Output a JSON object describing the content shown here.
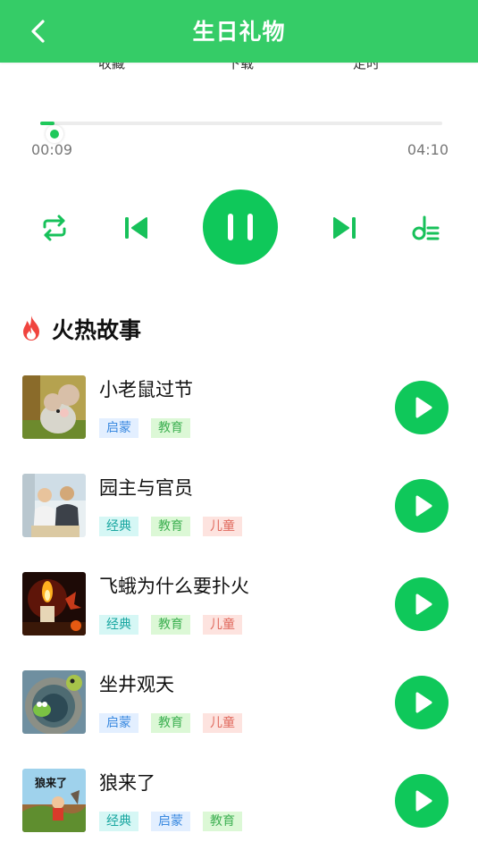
{
  "header": {
    "title": "生日礼物",
    "back_icon": "chevron-left-icon"
  },
  "actions": {
    "favorite": "收藏",
    "download": "下载",
    "timer": "定时"
  },
  "player": {
    "current_time": "00:09",
    "total_time": "04:10",
    "progress": 0.036,
    "state": "playing"
  },
  "controls": [
    "repeat-icon",
    "previous-icon",
    "pause-icon",
    "next-icon",
    "playlist-icon"
  ],
  "section": {
    "title": "火热故事",
    "icon": "fire-icon"
  },
  "stories": [
    {
      "title": "小老鼠过节",
      "tags": [
        {
          "text": "启蒙",
          "style": "blue"
        },
        {
          "text": "教育",
          "style": "green"
        }
      ]
    },
    {
      "title": "园主与官员",
      "tags": [
        {
          "text": "经典",
          "style": "cyan"
        },
        {
          "text": "教育",
          "style": "green"
        },
        {
          "text": "儿童",
          "style": "pink"
        }
      ]
    },
    {
      "title": "飞蛾为什么要扑火",
      "tags": [
        {
          "text": "经典",
          "style": "cyan"
        },
        {
          "text": "教育",
          "style": "green"
        },
        {
          "text": "儿童",
          "style": "pink"
        }
      ]
    },
    {
      "title": "坐井观天",
      "tags": [
        {
          "text": "启蒙",
          "style": "blue"
        },
        {
          "text": "教育",
          "style": "green"
        },
        {
          "text": "儿童",
          "style": "pink"
        }
      ]
    },
    {
      "title": "狼来了",
      "thumb_text": "狼来了",
      "tags": [
        {
          "text": "经典",
          "style": "cyan"
        },
        {
          "text": "启蒙",
          "style": "blue"
        },
        {
          "text": "教育",
          "style": "green"
        }
      ]
    }
  ],
  "colors": {
    "brand": "#35cc67",
    "accent": "#0fc85a",
    "fire": "#f0443e"
  }
}
